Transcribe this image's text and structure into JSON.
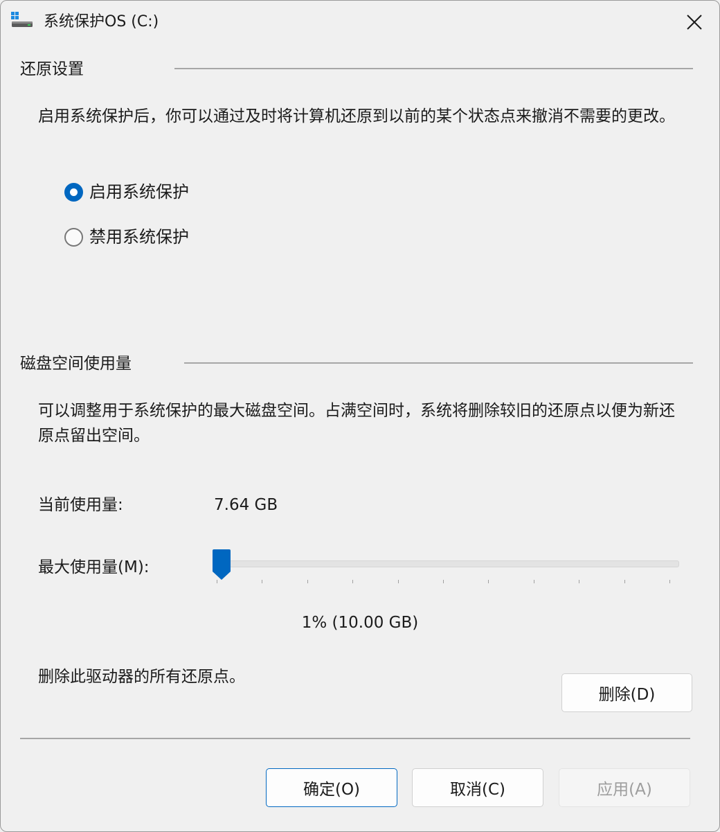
{
  "window": {
    "title": "系统保护OS (C:)",
    "icon": "drive-icon",
    "close_icon": "close-icon"
  },
  "restore_settings": {
    "heading": "还原设置",
    "description": "启用系统保护后，你可以通过及时将计算机还原到以前的某个状态点来撤消不需要的更改。",
    "options": [
      {
        "label": "启用系统保护",
        "checked": true
      },
      {
        "label": "禁用系统保护",
        "checked": false
      }
    ]
  },
  "disk_usage": {
    "heading": "磁盘空间使用量",
    "description": "可以调整用于系统保护的最大磁盘空间。占满空间时，系统将删除较旧的还原点以便为新还原点留出空间。",
    "current_label": "当前使用量:",
    "current_value": "7.64 GB",
    "max_label": "最大使用量(M):",
    "slider_percent": 1,
    "slider_value_text": "1% (10.00 GB)",
    "delete_text": "删除此驱动器的所有还原点。",
    "delete_button": "删除(D)"
  },
  "buttons": {
    "ok": "确定(O)",
    "cancel": "取消(C)",
    "apply": "应用(A)"
  },
  "colors": {
    "accent": "#0067c0",
    "background": "#f0f0f0"
  }
}
